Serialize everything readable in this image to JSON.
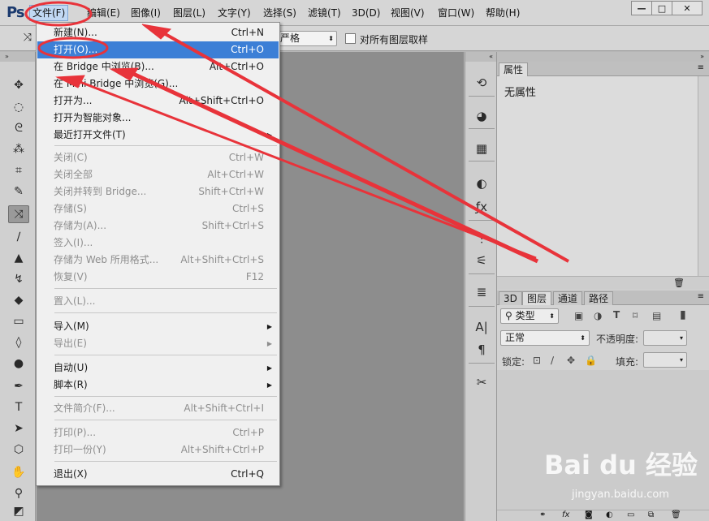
{
  "app": {
    "logo": "Ps"
  },
  "menubar": {
    "items": [
      "文件(F)",
      "编辑(E)",
      "图像(I)",
      "图层(L)",
      "文字(Y)",
      "选择(S)",
      "滤镜(T)",
      "3D(D)",
      "视图(V)",
      "窗口(W)",
      "帮助(H)"
    ],
    "active_index": 0
  },
  "window_controls": {
    "minimize": "—",
    "maximize": "□",
    "close": "✕"
  },
  "options_bar": {
    "select_value": "严格",
    "checkbox_label": "对所有图层取样"
  },
  "file_menu": {
    "items": [
      {
        "label": "新建(N)...",
        "shortcut": "Ctrl+N",
        "disabled": false
      },
      {
        "label": "打开(O)...",
        "shortcut": "Ctrl+O",
        "disabled": false,
        "highlighted": true
      },
      {
        "label": "在 Bridge 中浏览(B)...",
        "shortcut": "Alt+Ctrl+O",
        "disabled": false
      },
      {
        "label": "在 Mini Bridge 中浏览(G)...",
        "shortcut": "",
        "disabled": false
      },
      {
        "label": "打开为...",
        "shortcut": "Alt+Shift+Ctrl+O",
        "disabled": false
      },
      {
        "label": "打开为智能对象...",
        "shortcut": "",
        "disabled": false
      },
      {
        "label": "最近打开文件(T)",
        "shortcut": "",
        "disabled": false,
        "submenu": true
      },
      {
        "label": "关闭(C)",
        "shortcut": "Ctrl+W",
        "disabled": true
      },
      {
        "label": "关闭全部",
        "shortcut": "Alt+Ctrl+W",
        "disabled": true
      },
      {
        "label": "关闭并转到 Bridge...",
        "shortcut": "Shift+Ctrl+W",
        "disabled": true
      },
      {
        "label": "存储(S)",
        "shortcut": "Ctrl+S",
        "disabled": true
      },
      {
        "label": "存储为(A)...",
        "shortcut": "Shift+Ctrl+S",
        "disabled": true
      },
      {
        "label": "签入(I)...",
        "shortcut": "",
        "disabled": true
      },
      {
        "label": "存储为 Web 所用格式...",
        "shortcut": "Alt+Shift+Ctrl+S",
        "disabled": true
      },
      {
        "label": "恢复(V)",
        "shortcut": "F12",
        "disabled": true
      },
      {
        "label": "置入(L)...",
        "shortcut": "",
        "disabled": true
      },
      {
        "label": "导入(M)",
        "shortcut": "",
        "disabled": false,
        "submenu": true
      },
      {
        "label": "导出(E)",
        "shortcut": "",
        "disabled": true,
        "submenu": true
      },
      {
        "label": "自动(U)",
        "shortcut": "",
        "disabled": false,
        "submenu": true
      },
      {
        "label": "脚本(R)",
        "shortcut": "",
        "disabled": false,
        "submenu": true
      },
      {
        "label": "文件简介(F)...",
        "shortcut": "Alt+Shift+Ctrl+I",
        "disabled": true
      },
      {
        "label": "打印(P)...",
        "shortcut": "Ctrl+P",
        "disabled": true
      },
      {
        "label": "打印一份(Y)",
        "shortcut": "Alt+Shift+Ctrl+P",
        "disabled": true
      },
      {
        "label": "退出(X)",
        "shortcut": "Ctrl+Q",
        "disabled": false
      }
    ]
  },
  "properties_panel": {
    "tab": "属性",
    "empty_text": "无属性"
  },
  "layers_panel": {
    "tabs": [
      "3D",
      "图层",
      "通道",
      "路径"
    ],
    "active_tab": 1,
    "filter_value": "类型",
    "blend_mode": "正常",
    "opacity_label": "不透明度:",
    "lock_label": "锁定:",
    "fill_label": "填充:"
  },
  "watermark": {
    "logo": "Bai du 经验",
    "url": "jingyan.baidu.com"
  },
  "annotation_color": "#e8333a"
}
